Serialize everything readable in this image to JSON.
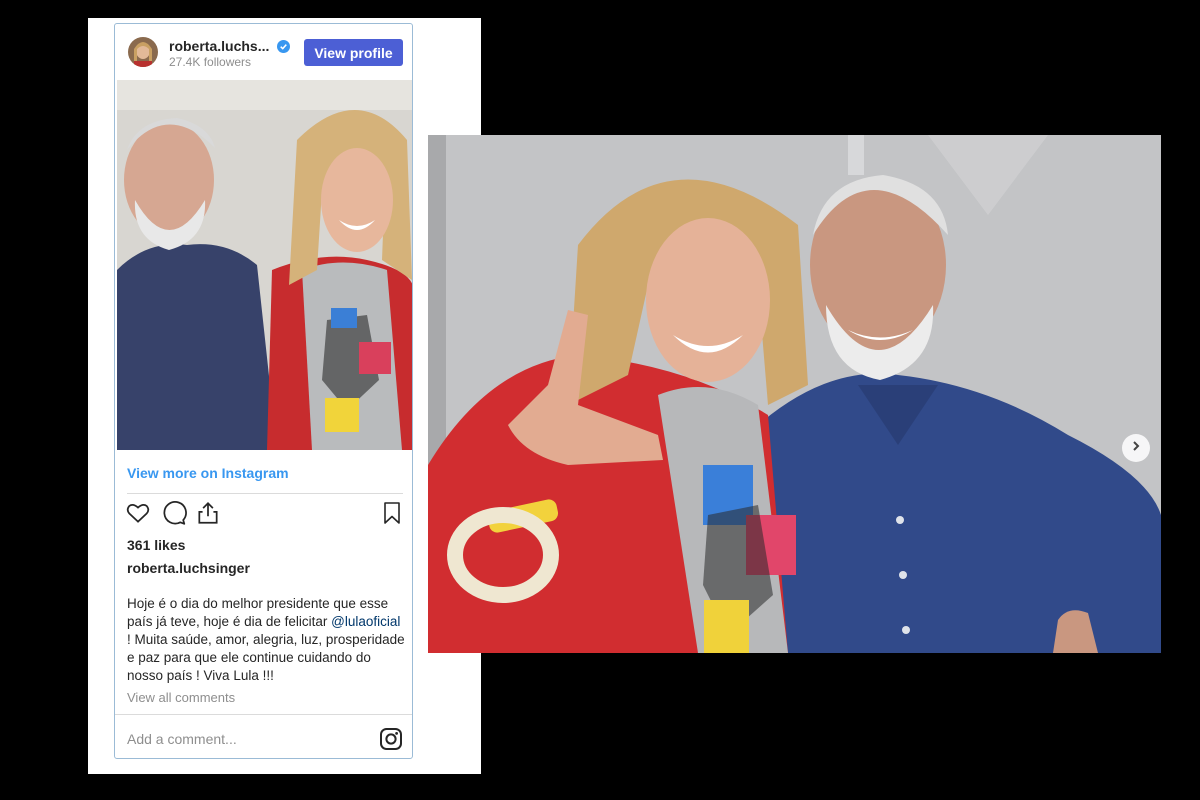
{
  "embed": {
    "username": "roberta.luchs...",
    "followers": "27.4K followers",
    "view_profile_label": "View profile",
    "view_more_label": "View more on Instagram",
    "likes": "361 likes",
    "caption_author": "roberta.luchsinger",
    "caption_before": "Hoje é o dia do melhor presidente que esse país já teve, hoje é dia de felicitar ",
    "caption_mention": "@lulaoficial",
    "caption_after": " ! Muita saúde, amor, alegria, luz, prosperidade e paz para que ele continue cuidando do nosso país ! Viva Lula !!!",
    "view_all_comments": "View all comments",
    "comment_placeholder": "Add a comment...",
    "accent_color": "#4c5fd5",
    "verified_icon": "verified-badge-icon"
  },
  "icons": [
    "heart-icon",
    "comment-icon",
    "share-icon",
    "bookmark-icon",
    "instagram-icon",
    "chevron-right-icon"
  ]
}
